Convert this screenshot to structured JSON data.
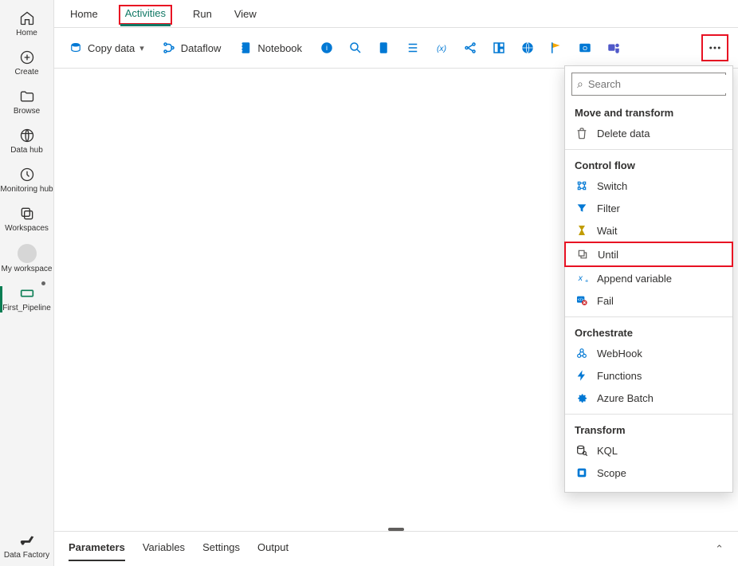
{
  "rail": {
    "items": [
      {
        "label": "Home"
      },
      {
        "label": "Create"
      },
      {
        "label": "Browse"
      },
      {
        "label": "Data hub"
      },
      {
        "label": "Monitoring hub"
      },
      {
        "label": "Workspaces"
      },
      {
        "label": "My workspace"
      },
      {
        "label": "First_Pipeline"
      }
    ],
    "footer_label": "Data Factory"
  },
  "tabs": {
    "items": [
      "Home",
      "Activities",
      "Run",
      "View"
    ],
    "active": "Activities"
  },
  "toolbar": {
    "copy_data": "Copy data",
    "dataflow": "Dataflow",
    "notebook": "Notebook"
  },
  "panel": {
    "search_placeholder": "Search",
    "sections": {
      "move": {
        "title": "Move and transform",
        "items": [
          "Delete data"
        ]
      },
      "control": {
        "title": "Control flow",
        "items": [
          "Switch",
          "Filter",
          "Wait",
          "Until",
          "Append variable",
          "Fail"
        ]
      },
      "orchestrate": {
        "title": "Orchestrate",
        "items": [
          "WebHook",
          "Functions",
          "Azure Batch"
        ]
      },
      "transform": {
        "title": "Transform",
        "items": [
          "KQL",
          "Scope"
        ]
      }
    }
  },
  "bottom": {
    "tabs": [
      "Parameters",
      "Variables",
      "Settings",
      "Output"
    ],
    "active": "Parameters"
  }
}
